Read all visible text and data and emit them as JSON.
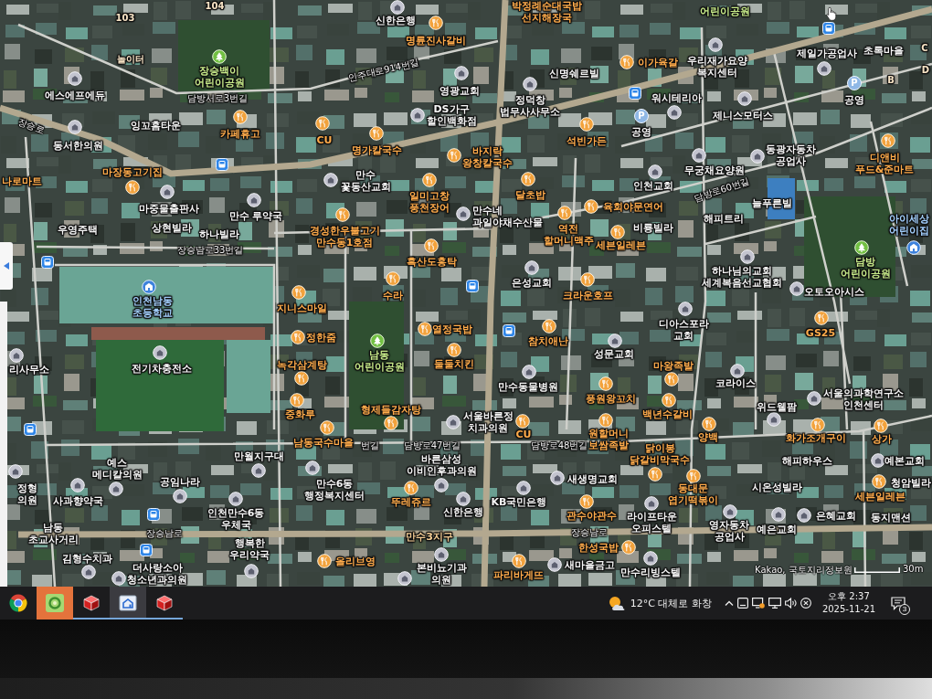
{
  "map": {
    "labels": [
      {
        "text": "104",
        "kind": "building"
      },
      {
        "text": "103",
        "kind": "building"
      },
      {
        "text": "신한은행",
        "kind": "place"
      },
      {
        "text": "박정례순대국밥\n선지해장국",
        "kind": "food"
      },
      {
        "text": "어린이공원",
        "kind": "park"
      },
      {
        "text": "명륜진사갈비",
        "kind": "food"
      },
      {
        "text": "놀이터",
        "kind": "building"
      },
      {
        "text": "장승백이\n어린이공원",
        "kind": "park"
      },
      {
        "text": "인주대로914번길",
        "kind": "road"
      },
      {
        "text": "신명쉐르빌",
        "kind": "place"
      },
      {
        "text": "이가육갈",
        "kind": "food"
      },
      {
        "text": "우리재가요양\n복지센터",
        "kind": "place"
      },
      {
        "text": "제일가공업사",
        "kind": "place"
      },
      {
        "text": "초록마을",
        "kind": "place"
      },
      {
        "text": "에스에프에듀",
        "kind": "place"
      },
      {
        "text": "담방서로3번길",
        "kind": "road"
      },
      {
        "text": "영광교회",
        "kind": "place"
      },
      {
        "text": "장승로",
        "kind": "road"
      },
      {
        "text": "잉꼬홈타운",
        "kind": "place"
      },
      {
        "text": "DS가구\n할인백화점",
        "kind": "place"
      },
      {
        "text": "정덕창\n법무사사무소",
        "kind": "place"
      },
      {
        "text": "워시테리아",
        "kind": "place"
      },
      {
        "text": "공영",
        "kind": "parking",
        "badge": "P"
      },
      {
        "text": "B",
        "kind": "building"
      },
      {
        "text": "C",
        "kind": "building"
      },
      {
        "text": "D",
        "kind": "building"
      },
      {
        "text": "카페휴고",
        "kind": "food"
      },
      {
        "text": "공영",
        "kind": "parking",
        "badge": "P"
      },
      {
        "text": "제니스모터스",
        "kind": "place"
      },
      {
        "text": "동서한의원",
        "kind": "place"
      },
      {
        "text": "CU",
        "kind": "food"
      },
      {
        "text": "명가칼국수",
        "kind": "food"
      },
      {
        "text": "석빈가든",
        "kind": "food"
      },
      {
        "text": "마장동고기집",
        "kind": "food"
      },
      {
        "text": "바지락\n왕창칼국수",
        "kind": "food"
      },
      {
        "text": "동광자동차\n공업사",
        "kind": "place"
      },
      {
        "text": "나로마트",
        "kind": "food"
      },
      {
        "text": "만수\n꽃동산교회",
        "kind": "place"
      },
      {
        "text": "무궁채요양원",
        "kind": "place"
      },
      {
        "text": "디앤비\n푸드&준마트",
        "kind": "food"
      },
      {
        "text": "마중물출판사",
        "kind": "place"
      },
      {
        "text": "만수 루약국",
        "kind": "place"
      },
      {
        "text": "일미고창\n풍천장어",
        "kind": "food"
      },
      {
        "text": "달초밥",
        "kind": "food"
      },
      {
        "text": "인천교회",
        "kind": "place"
      },
      {
        "text": "우영주택",
        "kind": "place"
      },
      {
        "text": "상현빌라",
        "kind": "place"
      },
      {
        "text": "하나빌라",
        "kind": "place"
      },
      {
        "text": "장승남로33번길",
        "kind": "road"
      },
      {
        "text": "경성한우불고기\n만수동1호점",
        "kind": "food"
      },
      {
        "text": "만수네\n과일야채수산물",
        "kind": "place"
      },
      {
        "text": "육회야문연어",
        "kind": "food"
      },
      {
        "text": "담방로60번길",
        "kind": "road"
      },
      {
        "text": "늘푸른빌",
        "kind": "place"
      },
      {
        "text": "해피트리",
        "kind": "place"
      },
      {
        "text": "역전\n할머니맥주",
        "kind": "food"
      },
      {
        "text": "비룡빌라",
        "kind": "place"
      },
      {
        "text": "아이세상\n어린이집",
        "kind": "childcare"
      },
      {
        "text": "세븐일레븐",
        "kind": "food"
      },
      {
        "text": "흑산도홍탁",
        "kind": "food"
      },
      {
        "text": "은성교회",
        "kind": "place"
      },
      {
        "text": "하나님의교회\n세계복음선교협회",
        "kind": "place"
      },
      {
        "text": "담방\n어린이공원",
        "kind": "park"
      },
      {
        "text": "인천남동\n초등학교",
        "kind": "school"
      },
      {
        "text": "수라",
        "kind": "food"
      },
      {
        "text": "크라운호프",
        "kind": "food"
      },
      {
        "text": "오토오아시스",
        "kind": "place"
      },
      {
        "text": "지니스마일",
        "kind": "food"
      },
      {
        "text": "정한줌",
        "kind": "food"
      },
      {
        "text": "열정국밥",
        "kind": "food"
      },
      {
        "text": "참치애난",
        "kind": "food"
      },
      {
        "text": "디아스포라\n교회",
        "kind": "place"
      },
      {
        "text": "GS25",
        "kind": "food"
      },
      {
        "text": "리사무소",
        "kind": "place"
      },
      {
        "text": "전기차충전소",
        "kind": "place"
      },
      {
        "text": "녹각삼계탕",
        "kind": "food"
      },
      {
        "text": "남동\n어린이공원",
        "kind": "park"
      },
      {
        "text": "둘둘치킨",
        "kind": "food"
      },
      {
        "text": "성문교회",
        "kind": "place"
      },
      {
        "text": "마왕족발",
        "kind": "food"
      },
      {
        "text": "만수동물병원",
        "kind": "place"
      },
      {
        "text": "코라이스",
        "kind": "place"
      },
      {
        "text": "풍원왕꼬치",
        "kind": "food"
      },
      {
        "text": "중화루",
        "kind": "food"
      },
      {
        "text": "형제들감자탕",
        "kind": "food"
      },
      {
        "text": "서울바른정\n치과의원",
        "kind": "place"
      },
      {
        "text": "백년수갈비",
        "kind": "food"
      },
      {
        "text": "위드웰팜",
        "kind": "place"
      },
      {
        "text": "서울의과학연구소\n인천센터",
        "kind": "place"
      },
      {
        "text": "남동국수마을",
        "kind": "food"
      },
      {
        "text": "번길",
        "kind": "road"
      },
      {
        "text": "담방로47번길",
        "kind": "road"
      },
      {
        "text": "CU",
        "kind": "food"
      },
      {
        "text": "담방로48번길",
        "kind": "road"
      },
      {
        "text": "원할머니\n보쌈족발",
        "kind": "food"
      },
      {
        "text": "양백",
        "kind": "food"
      },
      {
        "text": "예스\n메디칼의원",
        "kind": "place"
      },
      {
        "text": "만월지구대",
        "kind": "place"
      },
      {
        "text": "바른삼성\n이비인후과의원",
        "kind": "place"
      },
      {
        "text": "닭이봉\n닭갈비막국수",
        "kind": "food"
      },
      {
        "text": "화가조개구이",
        "kind": "food"
      },
      {
        "text": "상가",
        "kind": "food"
      },
      {
        "text": "해피하우스",
        "kind": "place"
      },
      {
        "text": "예본교회",
        "kind": "place"
      },
      {
        "text": "정형\n의원",
        "kind": "place"
      },
      {
        "text": "사과향약국",
        "kind": "place"
      },
      {
        "text": "공임나라",
        "kind": "place"
      },
      {
        "text": "만수6동\n행정복지센터",
        "kind": "place"
      },
      {
        "text": "뚜레쥬르",
        "kind": "food"
      },
      {
        "text": "KB국민은행",
        "kind": "place"
      },
      {
        "text": "새생명교회",
        "kind": "place"
      },
      {
        "text": "동대문\n엽기떡볶이",
        "kind": "food"
      },
      {
        "text": "시온성빌라",
        "kind": "place"
      },
      {
        "text": "세븐일레븐",
        "kind": "food"
      },
      {
        "text": "청암빌라",
        "kind": "place"
      },
      {
        "text": "남동\n초교사거리",
        "kind": "place"
      },
      {
        "text": "장승남로",
        "kind": "road"
      },
      {
        "text": "인천만수6동\n우체국",
        "kind": "place"
      },
      {
        "text": "신한은행",
        "kind": "place"
      },
      {
        "text": "관수야관수",
        "kind": "food"
      },
      {
        "text": "김형수치과",
        "kind": "place"
      },
      {
        "text": "행복한\n우리약국",
        "kind": "place"
      },
      {
        "text": "만수3지구",
        "kind": "area"
      },
      {
        "text": "장승남로",
        "kind": "road"
      },
      {
        "text": "라이프타운\n오피스텔",
        "kind": "place"
      },
      {
        "text": "영자동차\n공업사",
        "kind": "place"
      },
      {
        "text": "은혜교회",
        "kind": "place"
      },
      {
        "text": "동지맨션",
        "kind": "place"
      },
      {
        "text": "예은교회",
        "kind": "place"
      },
      {
        "text": "한성국밥",
        "kind": "food"
      },
      {
        "text": "더사랑소아\n청소년과의원",
        "kind": "place"
      },
      {
        "text": "올리브영",
        "kind": "food"
      },
      {
        "text": "본비뇨기과\n의원",
        "kind": "place"
      },
      {
        "text": "파리바게뜨",
        "kind": "food"
      },
      {
        "text": "새마을금고",
        "kind": "place"
      },
      {
        "text": "만수리빙스텔",
        "kind": "place"
      }
    ],
    "attribution": "Kakao, 국토지리정보원",
    "scale": "30m"
  },
  "taskbar": {
    "apps": [
      {
        "kind": "chrome",
        "running": false,
        "active": false,
        "flashing": false
      },
      {
        "kind": "ring",
        "running": false,
        "active": false,
        "flashing": true
      },
      {
        "kind": "cube",
        "running": true,
        "active": false,
        "flashing": false
      },
      {
        "kind": "house",
        "running": true,
        "active": true,
        "flashing": false
      },
      {
        "kind": "cube",
        "running": true,
        "active": false,
        "flashing": false
      }
    ],
    "weather": "12°C 대체로 화창",
    "time": "오후 2:37",
    "date": "2025-11-21",
    "notifications": "3"
  }
}
